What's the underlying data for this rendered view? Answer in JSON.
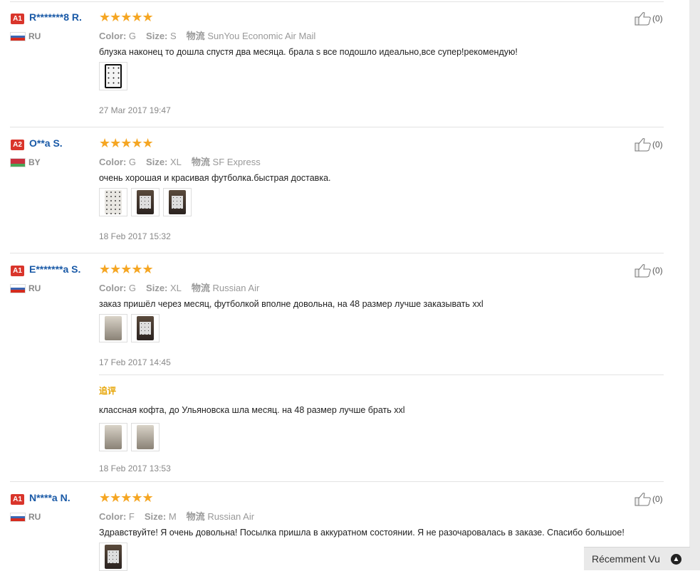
{
  "reviews": [
    {
      "badge": "A1",
      "user": "R*******8 R.",
      "country": "RU",
      "stars": "★★★★★",
      "color_label": "Color:",
      "color_value": "G",
      "size_label": "Size:",
      "size_value": "S",
      "shipping_label": "物流",
      "shipping_value": "SunYou Economic Air Mail",
      "text": "блузка наконец то дошла спустя два месяца. брала s все подошло идеально,все супер!рекомендую!",
      "date": "27 Mar 2017 19:47",
      "likes": "(0)"
    },
    {
      "badge": "A2",
      "user": "O**a S.",
      "country": "BY",
      "stars": "★★★★★",
      "color_label": "Color:",
      "color_value": "G",
      "size_label": "Size:",
      "size_value": "XL",
      "shipping_label": "物流",
      "shipping_value": "SF Express",
      "text": "очень хорошая и красивая футболка.быстрая доставка.",
      "date": "18 Feb 2017 15:32",
      "likes": "(0)"
    },
    {
      "badge": "A1",
      "user": "E*******a S.",
      "country": "RU",
      "stars": "★★★★★",
      "color_label": "Color:",
      "color_value": "G",
      "size_label": "Size:",
      "size_value": "XL",
      "shipping_label": "物流",
      "shipping_value": "Russian Air",
      "text": "заказ пришёл через месяц, футболкой вполне довольна, на 48 размер лучше заказывать xxl",
      "date": "17 Feb 2017 14:45",
      "likes": "(0)",
      "followup": {
        "label": "追评",
        "text": "классная кофта, до Ульяновска шла месяц. на 48 размер лучше брать xxl",
        "date": "18 Feb 2017 13:53"
      }
    },
    {
      "badge": "A1",
      "user": "N****a N.",
      "country": "RU",
      "stars": "★★★★★",
      "color_label": "Color:",
      "color_value": "F",
      "size_label": "Size:",
      "size_value": "M",
      "shipping_label": "物流",
      "shipping_value": "Russian Air",
      "text": "Здравствуйте! Я очень довольна! Посылка пришла в аккуратном состоянии. Я не разочаровалась в заказе. Спасибо большое!",
      "likes": "(0)"
    }
  ],
  "recently_viewed": {
    "label": "Récemment Vu",
    "icon": "chevron-up-icon"
  },
  "colors": {
    "badge": "#d9352b",
    "username": "#1a5aa7",
    "stars": "#f5a623",
    "followup_label": "#e6a300"
  }
}
